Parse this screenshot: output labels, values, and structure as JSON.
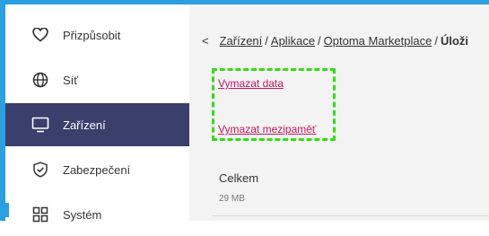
{
  "sidebar": {
    "items": [
      {
        "label": "Přizpůsobit",
        "icon": "heart-icon"
      },
      {
        "label": "Síť",
        "icon": "globe-icon"
      },
      {
        "label": "Zařízení",
        "icon": "monitor-icon",
        "active": true
      },
      {
        "label": "Zabezpečení",
        "icon": "shield-check-icon"
      },
      {
        "label": "Systém",
        "icon": "grid-icon"
      }
    ]
  },
  "breadcrumb": {
    "back": "<",
    "items": [
      "Zařízení",
      "Aplikace",
      "Optoma Marketplace"
    ],
    "separator": "/",
    "current": "Úloži"
  },
  "actions": {
    "clear_data": "Vymazat data",
    "clear_cache": "Vymazat mezipaměť"
  },
  "storage": {
    "total_label": "Celkem",
    "total_value": "29 MB"
  },
  "colors": {
    "accent": "#2aa0e0",
    "active_bg": "#3a3f6b",
    "link": "#c2185b",
    "highlight": "#33dd11"
  }
}
